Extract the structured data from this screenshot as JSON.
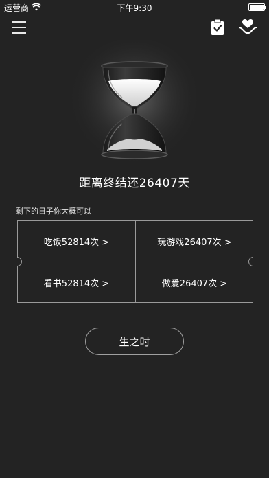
{
  "status_bar": {
    "carrier": "运营商",
    "time": "下午9:30",
    "wifi_icon": "wifi-icon",
    "battery_level": 1.0
  },
  "nav": {
    "menu_icon": "hamburger-menu-icon",
    "clipboard_icon": "clipboard-check-icon",
    "heart_hand_icon": "heart-hand-icon"
  },
  "main": {
    "hourglass_icon": "hourglass-icon",
    "countdown_text": "距离终结还26407天",
    "subtitle": "剩下的日子你大概可以"
  },
  "activities": [
    {
      "label": "吃饭52814次 >"
    },
    {
      "label": "玩游戏26407次 >"
    },
    {
      "label": "看书52814次 >"
    },
    {
      "label": "做爱26407次 >"
    }
  ],
  "birth_button": {
    "label": "生之时"
  },
  "colors": {
    "background": "#232323",
    "border": "#9a9a9a",
    "text": "#ffffff"
  }
}
